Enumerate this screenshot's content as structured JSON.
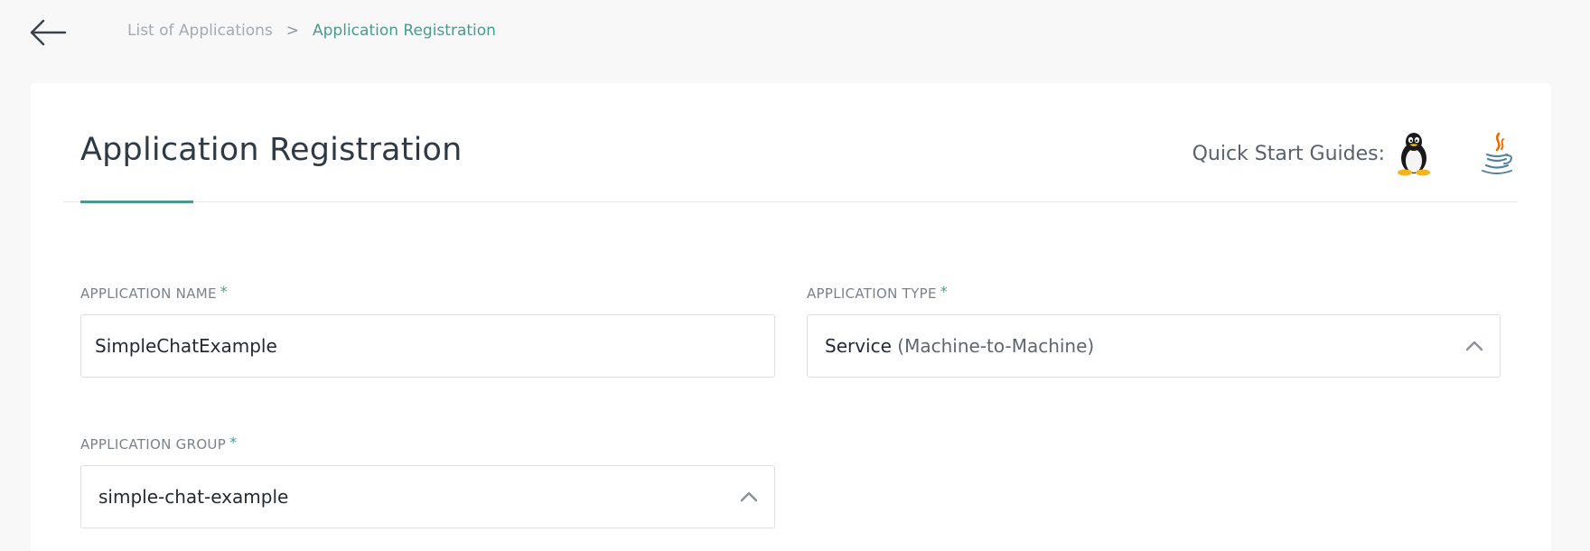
{
  "breadcrumb": {
    "parent": "List of Applications",
    "separator": ">",
    "current": "Application Registration"
  },
  "page": {
    "title": "Application Registration",
    "quick_start_label": "Quick Start Guides:",
    "guides": [
      {
        "icon": "linux-tux-icon"
      },
      {
        "icon": "java-icon"
      }
    ]
  },
  "form": {
    "app_name": {
      "label": "APPLICATION NAME",
      "required_mark": "*",
      "value": "SimpleChatExample"
    },
    "app_type": {
      "label": "APPLICATION TYPE",
      "required_mark": "*",
      "value": "Service",
      "value_detail": "(Machine-to-Machine)"
    },
    "app_group": {
      "label": "APPLICATION GROUP",
      "required_mark": "*",
      "value": "simple-chat-example"
    }
  },
  "colors": {
    "accent": "#4a9b8f",
    "background": "#f8f8f8",
    "card": "#ffffff"
  }
}
